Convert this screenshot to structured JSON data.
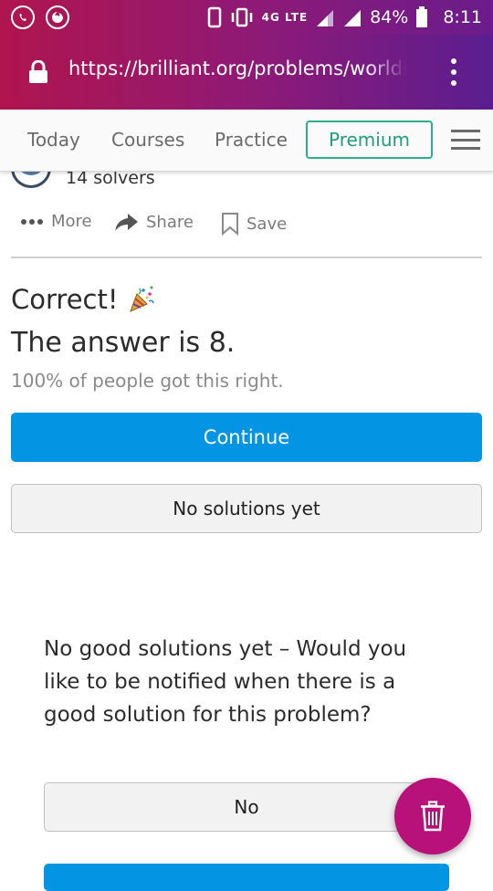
{
  "status_bar": {
    "network": "4G LTE",
    "battery": "84%",
    "time": "8:11"
  },
  "browser": {
    "url": "https://brilliant.org/problems/worlds-"
  },
  "nav": {
    "items": [
      "Today",
      "Courses",
      "Practice"
    ],
    "premium_label": "Premium"
  },
  "problem": {
    "solvers": "14 solvers",
    "actions": {
      "more": "More",
      "share": "Share",
      "save": "Save"
    }
  },
  "result": {
    "title": "Correct!",
    "answer": "The answer is 8.",
    "percent": "100% of people got this right.",
    "continue_label": "Continue",
    "no_solutions_label": "No solutions yet"
  },
  "notify": {
    "question": "No good solutions yet – Would you like to be notified when there is a good solution for this problem?",
    "no_label": "No"
  },
  "colors": {
    "primary_blue": "#0494e4",
    "premium_green": "#2fae8c",
    "fab_magenta": "#b8127a"
  }
}
